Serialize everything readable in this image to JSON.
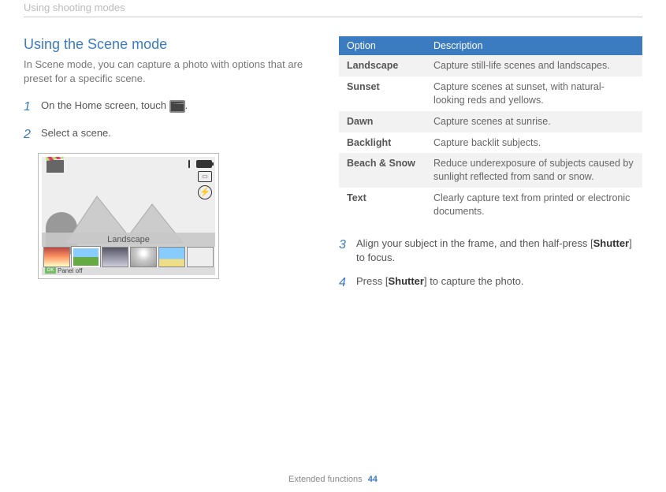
{
  "header": {
    "breadcrumb": "Using shooting modes"
  },
  "left": {
    "title": "Using the Scene mode",
    "intro": "In Scene mode, you can capture a photo with options that are preset for a specific scene.",
    "steps": {
      "s1_num": "1",
      "s1_prefix": "On the Home screen, touch ",
      "s1_suffix": ".",
      "s2_num": "2",
      "s2_text": "Select a scene."
    },
    "screenshot": {
      "mode_label": "Landscape",
      "panel_off": "Panel off",
      "ok": "OK"
    }
  },
  "table": {
    "headers": {
      "option": "Option",
      "description": "Description"
    },
    "rows": [
      {
        "option": "Landscape",
        "description": "Capture still-life scenes and landscapes."
      },
      {
        "option": "Sunset",
        "description": "Capture scenes at sunset, with natural-looking reds and yellows."
      },
      {
        "option": "Dawn",
        "description": "Capture scenes at sunrise."
      },
      {
        "option": "Backlight",
        "description": "Capture backlit subjects."
      },
      {
        "option": "Beach & Snow",
        "description": "Reduce underexposure of subjects caused by sunlight reflected from sand or snow."
      },
      {
        "option": "Text",
        "description": "Clearly capture text from printed or electronic documents."
      }
    ]
  },
  "right_steps": {
    "s3_num": "3",
    "s3_prefix": "Align your subject in the frame, and then half-press [",
    "s3_bold": "Shutter",
    "s3_suffix": "] to focus.",
    "s4_num": "4",
    "s4_prefix": "Press [",
    "s4_bold": "Shutter",
    "s4_suffix": "] to capture the photo."
  },
  "footer": {
    "section": "Extended functions",
    "page": "44"
  }
}
